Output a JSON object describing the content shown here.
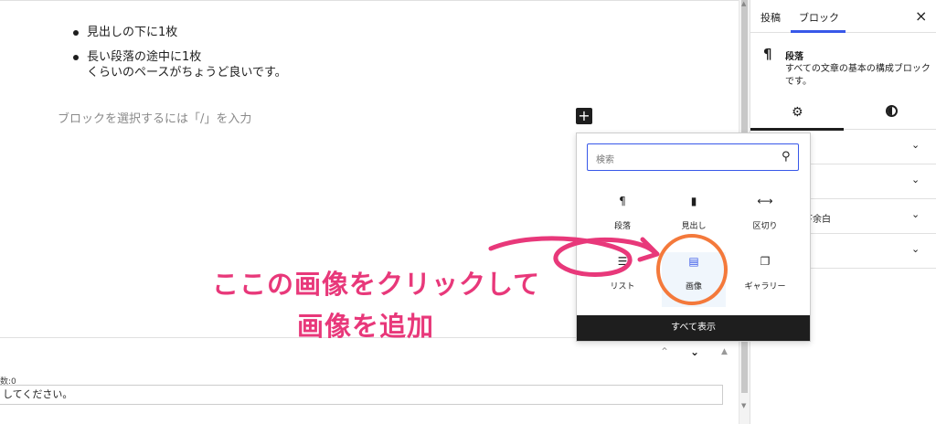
{
  "editor": {
    "bullets": [
      "見出しの下に1枚",
      "長い段落の途中に1枚"
    ],
    "paragraph": "くらいのペースがちょうど良いです。",
    "placeholder": "ブロックを選択するには「/」を入力",
    "add_block_label": "+"
  },
  "meta": {
    "arrow_up": "^",
    "arrow_down": "v",
    "count_label": "数:0",
    "input_text": "してください。"
  },
  "sidebar": {
    "tabs": [
      "投稿",
      "ブロック"
    ],
    "active_tab": "ブロック",
    "close_label": "×",
    "block_icon": "¶",
    "block_title": "段落",
    "block_description": "すべての文章の基本の構成ブロックです。",
    "panels": [
      "",
      "",
      "下余白",
      ""
    ]
  },
  "inserter": {
    "search_placeholder": "検索",
    "items": [
      {
        "label": "段落",
        "icon": "pilcrow-icon"
      },
      {
        "label": "見出し",
        "icon": "bookmark-icon"
      },
      {
        "label": "区切り",
        "icon": "separator-icon"
      },
      {
        "label": "リスト",
        "icon": "list-icon"
      },
      {
        "label": "画像",
        "icon": "image-icon"
      },
      {
        "label": "ギャラリー",
        "icon": "gallery-icon"
      }
    ],
    "selected_item": "画像",
    "show_all_label": "すべて表示"
  },
  "annotation": {
    "line1": "ここの画像をクリックして",
    "line2": "画像を追加",
    "accent_color": "#e8387a",
    "circle_color": "#f4793b"
  }
}
